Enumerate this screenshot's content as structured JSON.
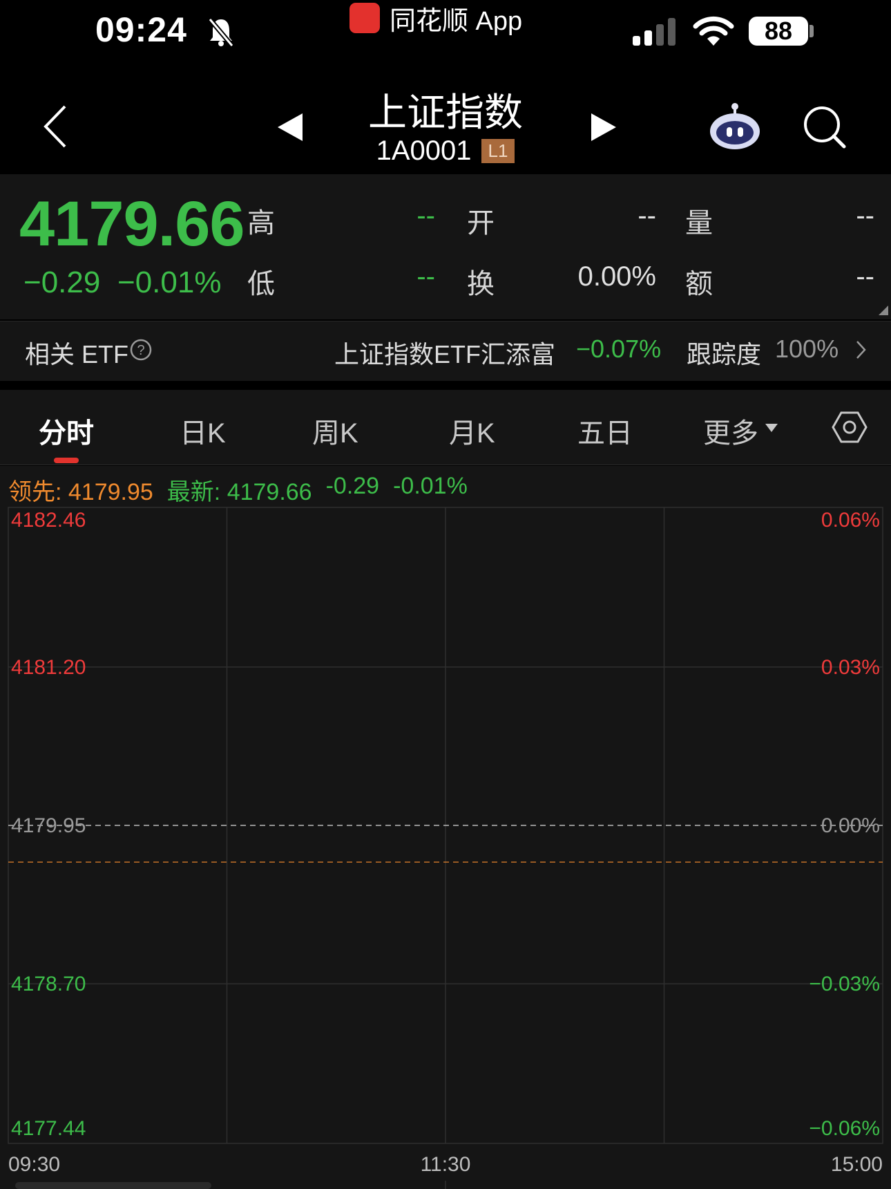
{
  "status_bar": {
    "time": "09:24",
    "app_name": "同花顺 App",
    "battery": "88"
  },
  "nav": {
    "title": "上证指数",
    "code": "1A0001",
    "level": "L1"
  },
  "quote": {
    "price": "4179.66",
    "change": "−0.29",
    "change_pct": "−0.01%",
    "high_label": "高",
    "high": "--",
    "low_label": "低",
    "low": "--",
    "open_label": "开",
    "open": "--",
    "turnover_label": "换",
    "turnover": "0.00%",
    "volume_label": "量",
    "volume": "--",
    "amount_label": "额",
    "amount": "--"
  },
  "etf": {
    "label": "相关 ETF",
    "name": "上证指数ETF汇添富",
    "change": "−0.07%",
    "tracking_label": "跟踪度",
    "tracking": "100%"
  },
  "tabs": [
    "分时",
    "日K",
    "周K",
    "月K",
    "五日",
    "更多"
  ],
  "chart_info": {
    "lead": "领先: 4179.95",
    "latest": "最新: 4179.66",
    "change": "-0.29",
    "change_pct": "-0.01%"
  },
  "chart_data": {
    "type": "line",
    "series": [],
    "reference_price": 4179.95,
    "current_price": 4179.66,
    "ylim": [
      4177.44,
      4182.46
    ],
    "y_ticks_left": [
      "4182.46",
      "4181.20",
      "4179.95",
      "4178.70",
      "4177.44"
    ],
    "y_ticks_right": [
      "0.06%",
      "0.03%",
      "0.00%",
      "−0.03%",
      "−0.06%"
    ],
    "x_ticks": [
      "09:30",
      "11:30",
      "15:00"
    ],
    "grid": true
  },
  "colors": {
    "up": "#ef3b3b",
    "down": "#3dbd4a",
    "neutral": "#9a9a9a",
    "accent": "#ef8a2e"
  }
}
